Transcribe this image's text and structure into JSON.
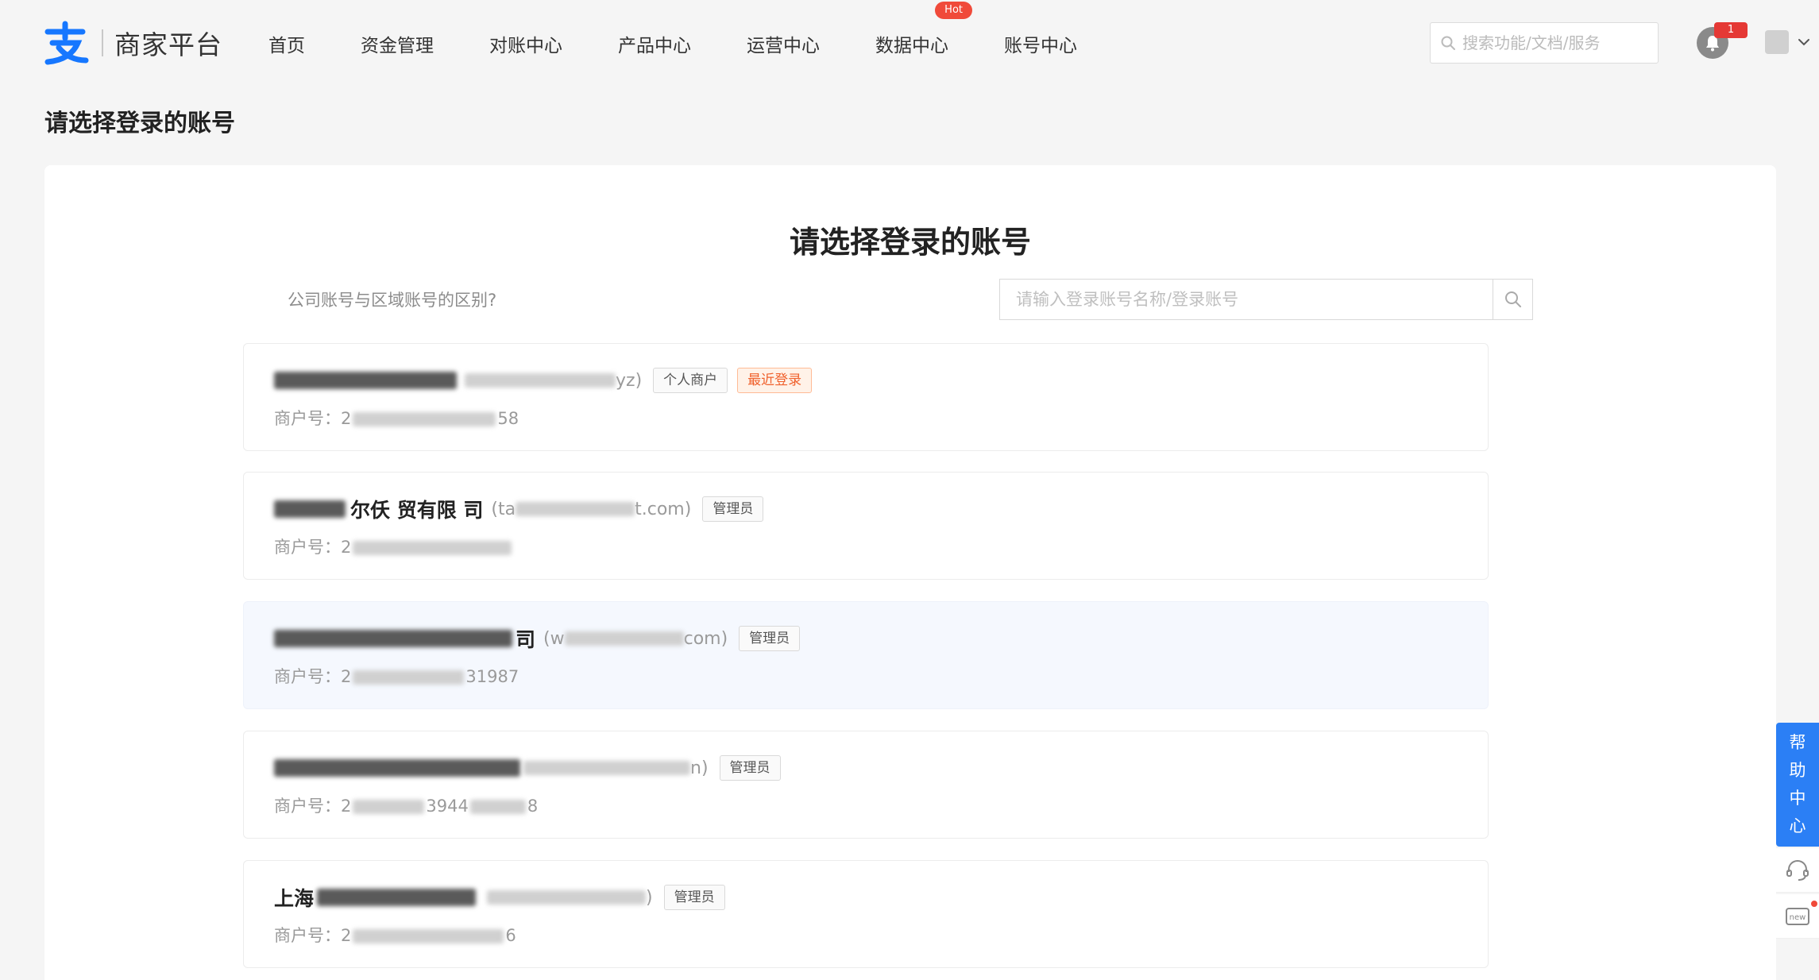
{
  "brand": {
    "name": "商家平台",
    "logo_color": "#1677ff"
  },
  "nav": [
    {
      "label": "首页"
    },
    {
      "label": "资金管理"
    },
    {
      "label": "对账中心"
    },
    {
      "label": "产品中心"
    },
    {
      "label": "运营中心"
    },
    {
      "label": "数据中心",
      "badge": "Hot"
    },
    {
      "label": "账号中心"
    }
  ],
  "header": {
    "search_placeholder": "搜索功能/文档/服务",
    "notification_count": "1"
  },
  "page_title": "请选择登录的账号",
  "panel": {
    "title": "请选择登录的账号",
    "diff_link": "公司账号与区域账号的区别?",
    "search_placeholder": "请输入登录账号名称/登录账号"
  },
  "accounts": [
    {
      "name_visible": "",
      "login_suffix": "yz)",
      "tags": [
        "个人商户",
        "最近登录"
      ],
      "merchant_label": "商户号：",
      "merchant_prefix": "2",
      "merchant_suffix": "58"
    },
    {
      "name_visible": "尔仸  贸有限  司",
      "login_prefix": "(ta",
      "login_suffix": "t.com)",
      "tags": [
        "管理员"
      ],
      "merchant_label": "商户号：",
      "merchant_prefix": "2",
      "merchant_suffix": ""
    },
    {
      "name_visible": "司",
      "login_prefix": "(w",
      "login_suffix": "com)",
      "tags": [
        "管理员"
      ],
      "merchant_label": "商户号：",
      "merchant_prefix": "2",
      "merchant_suffix": "31987"
    },
    {
      "name_visible": "",
      "login_suffix": "n)",
      "tags": [
        "管理员"
      ],
      "merchant_label": "商户号：",
      "merchant_prefix": "2",
      "merchant_middle": "3944",
      "merchant_suffix": "8"
    },
    {
      "name_visible": "上海",
      "login_suffix": ")",
      "tags": [
        "管理员"
      ],
      "merchant_label": "商户号：",
      "merchant_prefix": "2",
      "merchant_suffix": "6"
    }
  ],
  "help": {
    "chars": [
      "帮",
      "助",
      "中",
      "心"
    ],
    "new_label": "new",
    "accent_color": "#2b7ff5"
  },
  "colors": {
    "recent_tag_text": "#f0612d",
    "recent_tag_bg": "#fff2e8",
    "hot_badge": "#f04a3a"
  }
}
